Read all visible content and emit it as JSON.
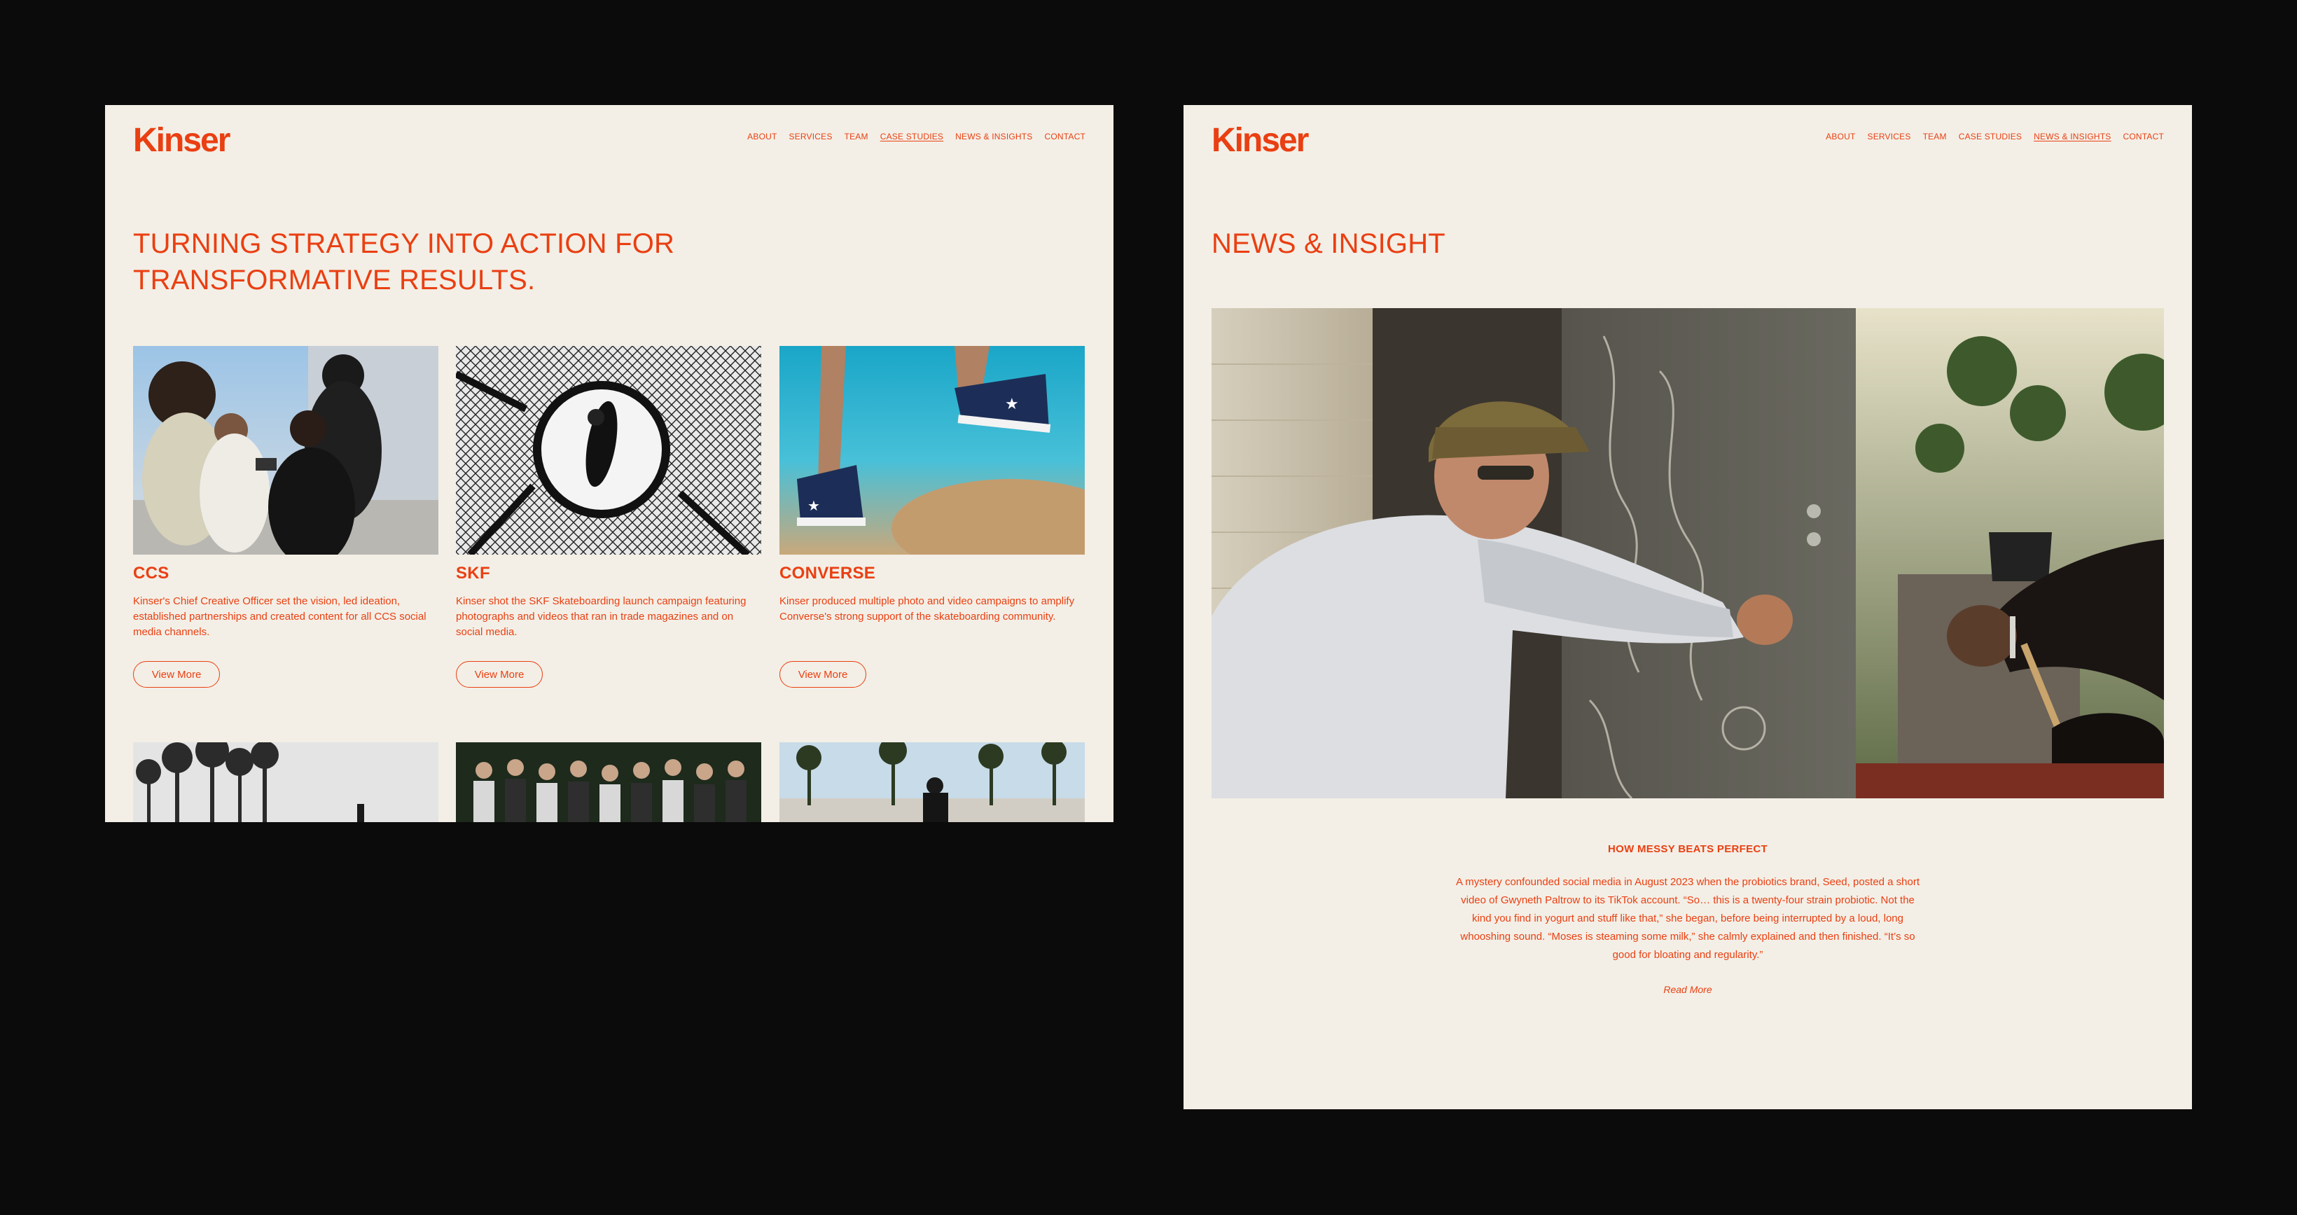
{
  "brand": {
    "name": "Kinser",
    "accent": "#ea3f12",
    "paper": "#f3efe6",
    "background": "#0b0b0b"
  },
  "left": {
    "nav": [
      {
        "label": "ABOUT",
        "active": false
      },
      {
        "label": "SERVICES",
        "active": false
      },
      {
        "label": "TEAM",
        "active": false
      },
      {
        "label": "CASE STUDIES",
        "active": true
      },
      {
        "label": "NEWS & INSIGHTS",
        "active": false
      },
      {
        "label": "CONTACT",
        "active": false
      }
    ],
    "headline_line1": "TURNING STRATEGY INTO ACTION FOR",
    "headline_line2": "TRANSFORMATIVE RESULTS.",
    "cards": [
      {
        "title": "CCS",
        "description": "Kinser's Chief Creative Officer set the vision, led ideation, established partnerships and created content for all CCS social media channels.",
        "button": "View More",
        "image": "group-of-skaters-looking-at-phone-photo"
      },
      {
        "title": "SKF",
        "description": "Kinser shot the SKF Skateboarding launch campaign featuring photographs and videos that ran in trade magazines and on social media.",
        "button": "View More",
        "image": "skater-overhead-fisheye-photo"
      },
      {
        "title": "CONVERSE",
        "description": "Kinser produced multiple photo and video campaigns to amplify Converse's strong support of the skateboarding community.",
        "button": "View More",
        "image": "converse-sneakers-underwater-photo"
      }
    ],
    "thumbnails": [
      "palm-trees-skater-photo",
      "crowd-of-skaters-photo",
      "skatepark-palm-trees-photo"
    ]
  },
  "right": {
    "nav": [
      {
        "label": "ABOUT",
        "active": false
      },
      {
        "label": "SERVICES",
        "active": false
      },
      {
        "label": "TEAM",
        "active": false
      },
      {
        "label": "CASE STUDIES",
        "active": false
      },
      {
        "label": "NEWS & INSIGHTS",
        "active": true
      },
      {
        "label": "CONTACT",
        "active": false
      }
    ],
    "page_title": "NEWS & INSIGHT",
    "hero_image": "man-in-plaid-cap-drawing-on-door-photo",
    "article_title": "HOW MESSY BEATS PERFECT",
    "article_body": "A mystery confounded social media in August 2023 when the probiotics brand, Seed, posted a short video of Gwyneth Paltrow to its TikTok account. “So… this is a twenty-four strain probiotic. Not the kind you find in yogurt and stuff like that,” she began, before being interrupted by a loud, long whooshing sound. “Moses is steaming some milk,” she calmly explained and then finished. “It’s so good for bloating and regularity.”",
    "read_more": "Read More"
  }
}
